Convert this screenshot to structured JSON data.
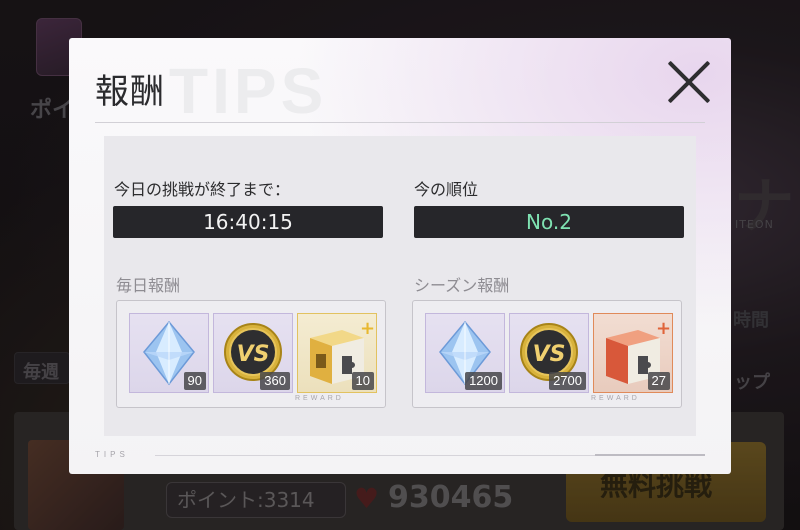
{
  "background": {
    "top_text": "ポイ",
    "right_title": "ナ",
    "right_subtitle": "ITEON",
    "right_time": "時間",
    "weekly_label": "毎週",
    "shop_label": "ップ",
    "points_label": "ポイント:3314",
    "score": "930465",
    "free_challenge": "無料挑戦"
  },
  "modal": {
    "title": "報酬",
    "watermark": "TIPS",
    "countdown_label": "今日の挑戦が終了まで：",
    "countdown_value": "16:40:15",
    "rank_label": "今の順位",
    "rank_value": "No.2",
    "daily": {
      "label": "毎日報酬",
      "items": [
        {
          "icon": "blue-crystal-icon",
          "count": "90"
        },
        {
          "icon": "vs-coin-icon",
          "count": "360"
        },
        {
          "icon": "gold-puzzle-box-icon",
          "count": "10"
        }
      ],
      "caption": "REWARD"
    },
    "season": {
      "label": "シーズン報酬",
      "items": [
        {
          "icon": "blue-crystal-icon",
          "count": "1200"
        },
        {
          "icon": "vs-coin-icon",
          "count": "2700"
        },
        {
          "icon": "red-puzzle-box-icon",
          "count": "27"
        }
      ],
      "caption": "REWARD"
    },
    "tips_label": "TIPS"
  },
  "colors": {
    "rank_text": "#7fe2b2",
    "dark_bar": "#26262a",
    "gold_frame": "#e2c260",
    "orange_frame": "#e08a5a"
  }
}
